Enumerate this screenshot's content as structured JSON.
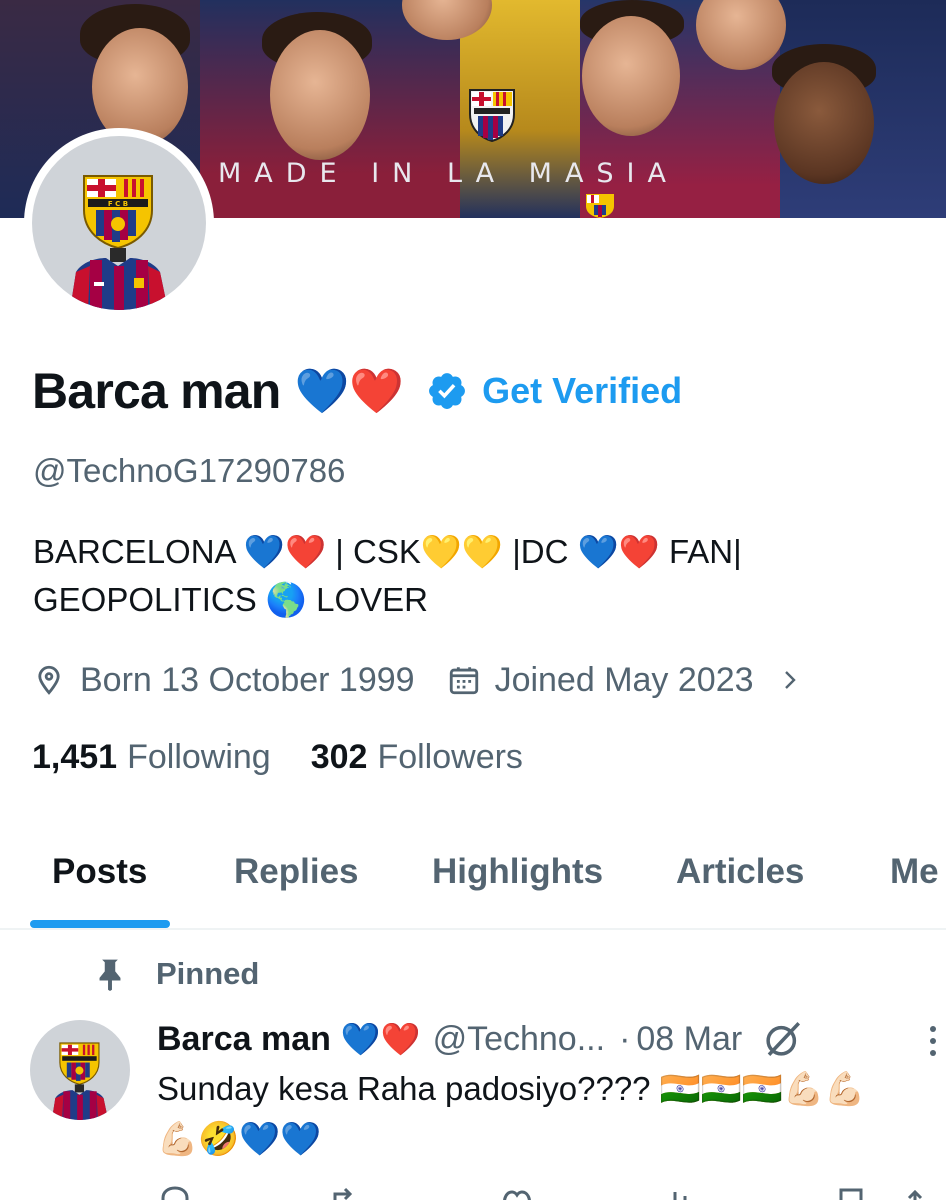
{
  "banner": {
    "text": "MADE IN LA MASIA"
  },
  "profile": {
    "display_name": "Barca man",
    "name_emojis": "💙❤️",
    "get_verified": "Get Verified",
    "handle": "@TechnoG17290786",
    "bio_line1": "BARCELONA 💙❤️ | CSK💛💛 |DC 💙❤️ FAN|",
    "bio_line2": "GEOPOLITICS 🌎 LOVER",
    "born": "Born 13 October 1999",
    "joined": "Joined May 2023",
    "following_count": "1,451",
    "following_label": "Following",
    "followers_count": "302",
    "followers_label": "Followers"
  },
  "tabs": [
    {
      "label": "Posts",
      "active": true
    },
    {
      "label": "Replies",
      "active": false
    },
    {
      "label": "Highlights",
      "active": false
    },
    {
      "label": "Articles",
      "active": false
    },
    {
      "label": "Me",
      "active": false
    }
  ],
  "pinned": {
    "label": "Pinned",
    "post": {
      "name": "Barca man",
      "emojis": "💙❤️",
      "handle": "@Techno...",
      "date": "08 Mar",
      "text_line1": "Sunday kesa Raha padosiyo???? 🇮🇳🇮🇳🇮🇳💪🏻💪🏻",
      "text_line2": "💪🏻🤣💙💙"
    }
  },
  "colors": {
    "accent": "#1d9bf0",
    "secondary_text": "#536471",
    "primary_text": "#0f1419"
  },
  "icons": {
    "location": "location-pin-icon",
    "calendar": "calendar-icon",
    "chevron": "chevron-right-icon",
    "verified": "verified-badge-icon",
    "pin": "pin-icon",
    "grok": "grok-icon",
    "more": "more-vertical-icon"
  }
}
